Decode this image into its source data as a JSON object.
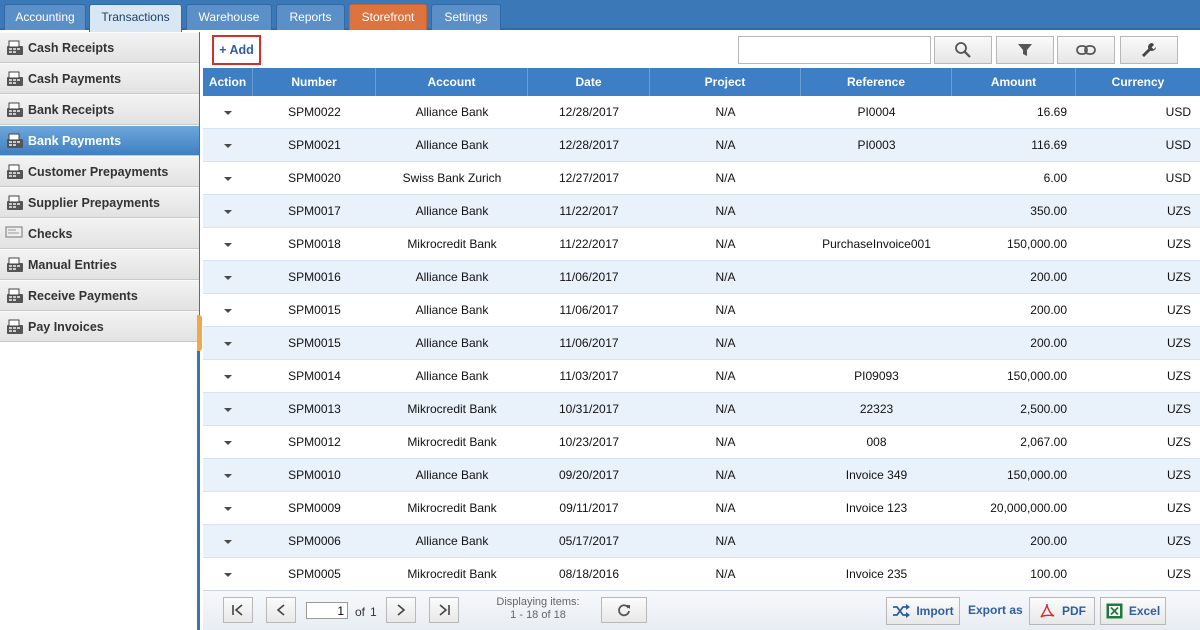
{
  "nav": {
    "tabs": [
      {
        "label": "Accounting"
      },
      {
        "label": "Transactions"
      },
      {
        "label": "Warehouse"
      },
      {
        "label": "Reports"
      },
      {
        "label": "Storefront"
      },
      {
        "label": "Settings"
      }
    ],
    "active_tab": "Transactions",
    "accent_tab": "Storefront"
  },
  "sidebar": {
    "items": [
      {
        "label": "Cash Receipts",
        "icon": "cash-register-icon"
      },
      {
        "label": "Cash Payments",
        "icon": "cash-register-icon"
      },
      {
        "label": "Bank Receipts",
        "icon": "cash-register-icon"
      },
      {
        "label": "Bank Payments",
        "icon": "cash-register-icon"
      },
      {
        "label": "Customer Prepayments",
        "icon": "cash-register-icon"
      },
      {
        "label": "Supplier Prepayments",
        "icon": "cash-register-icon"
      },
      {
        "label": "Checks",
        "icon": "check-icon"
      },
      {
        "label": "Manual Entries",
        "icon": "cash-register-icon"
      },
      {
        "label": "Receive Payments",
        "icon": "cash-register-icon"
      },
      {
        "label": "Pay Invoices",
        "icon": "cash-register-icon"
      }
    ],
    "active_item": "Bank Payments"
  },
  "toolbar": {
    "add_label": "+ Add",
    "search_value": "",
    "icons": [
      "search-icon",
      "filter-icon",
      "link-icon",
      "wrench-icon"
    ]
  },
  "grid": {
    "columns": [
      "Action",
      "Number",
      "Account",
      "Date",
      "Project",
      "Reference",
      "Amount",
      "Currency"
    ],
    "rows": [
      {
        "number": "SPM0022",
        "account": "Alliance Bank",
        "date": "12/28/2017",
        "project": "N/A",
        "reference": "PI0004",
        "amount": "16.69",
        "currency": "USD"
      },
      {
        "number": "SPM0021",
        "account": "Alliance Bank",
        "date": "12/28/2017",
        "project": "N/A",
        "reference": "PI0003",
        "amount": "116.69",
        "currency": "USD"
      },
      {
        "number": "SPM0020",
        "account": "Swiss Bank Zurich",
        "date": "12/27/2017",
        "project": "N/A",
        "reference": "",
        "amount": "6.00",
        "currency": "USD"
      },
      {
        "number": "SPM0017",
        "account": "Alliance Bank",
        "date": "11/22/2017",
        "project": "N/A",
        "reference": "",
        "amount": "350.00",
        "currency": "UZS"
      },
      {
        "number": "SPM0018",
        "account": "Mikrocredit Bank",
        "date": "11/22/2017",
        "project": "N/A",
        "reference": "PurchaseInvoice001",
        "amount": "150,000.00",
        "currency": "UZS"
      },
      {
        "number": "SPM0016",
        "account": "Alliance Bank",
        "date": "11/06/2017",
        "project": "N/A",
        "reference": "",
        "amount": "200.00",
        "currency": "UZS"
      },
      {
        "number": "SPM0015",
        "account": "Alliance Bank",
        "date": "11/06/2017",
        "project": "N/A",
        "reference": "",
        "amount": "200.00",
        "currency": "UZS"
      },
      {
        "number": "SPM0015",
        "account": "Alliance Bank",
        "date": "11/06/2017",
        "project": "N/A",
        "reference": "",
        "amount": "200.00",
        "currency": "UZS"
      },
      {
        "number": "SPM0014",
        "account": "Alliance Bank",
        "date": "11/03/2017",
        "project": "N/A",
        "reference": "PI09093",
        "amount": "150,000.00",
        "currency": "UZS"
      },
      {
        "number": "SPM0013",
        "account": "Mikrocredit Bank",
        "date": "10/31/2017",
        "project": "N/A",
        "reference": "22323",
        "amount": "2,500.00",
        "currency": "UZS"
      },
      {
        "number": "SPM0012",
        "account": "Mikrocredit Bank",
        "date": "10/23/2017",
        "project": "N/A",
        "reference": "008",
        "amount": "2,067.00",
        "currency": "UZS"
      },
      {
        "number": "SPM0010",
        "account": "Alliance Bank",
        "date": "09/20/2017",
        "project": "N/A",
        "reference": "Invoice 349",
        "amount": "150,000.00",
        "currency": "UZS"
      },
      {
        "number": "SPM0009",
        "account": "Mikrocredit Bank",
        "date": "09/11/2017",
        "project": "N/A",
        "reference": "Invoice 123",
        "amount": "20,000,000.00",
        "currency": "UZS"
      },
      {
        "number": "SPM0006",
        "account": "Alliance Bank",
        "date": "05/17/2017",
        "project": "N/A",
        "reference": "",
        "amount": "200.00",
        "currency": "UZS"
      },
      {
        "number": "SPM0005",
        "account": "Mikrocredit Bank",
        "date": "08/18/2016",
        "project": "N/A",
        "reference": "Invoice 235",
        "amount": "100.00",
        "currency": "UZS"
      }
    ]
  },
  "pager": {
    "page_value": "1",
    "of_label": "of",
    "total_pages": "1",
    "displaying_label": "Displaying items:",
    "displaying_range": "1 - 18 of 18",
    "import_label": "Import",
    "export_as_label": "Export as",
    "pdf_label": "PDF",
    "excel_label": "Excel"
  },
  "colors": {
    "nav_bg": "#3a78b8",
    "accent": "#dd7440",
    "header_bg": "#3d7ec4",
    "row_alt": "#e9f1fb",
    "add_border": "#d0312d"
  }
}
